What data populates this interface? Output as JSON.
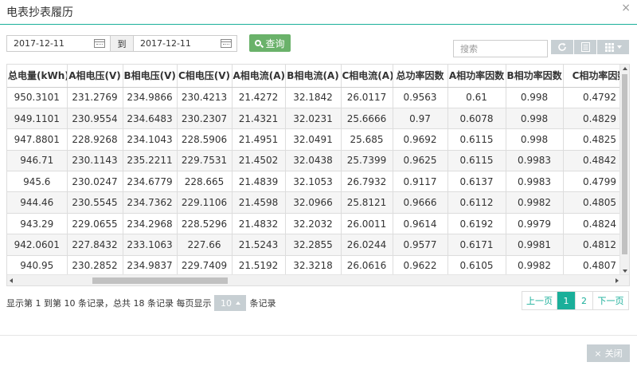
{
  "dialog": {
    "title": "电表抄表履历",
    "close_glyph": "×"
  },
  "filters": {
    "date_from": "2017-12-11",
    "to_label": "到",
    "date_to": "2017-12-11",
    "query_label": "查询"
  },
  "toolbar": {
    "search_placeholder": "搜索",
    "icons": [
      "refresh-icon",
      "list-icon",
      "grid-icon"
    ]
  },
  "table": {
    "columns": [
      "总电量(kWh)",
      "A相电压(V)",
      "B相电压(V)",
      "C相电压(V)",
      "A相电流(A)",
      "B相电流(A)",
      "C相电流(A)",
      "总功率因数",
      "A相功率因数",
      "B相功率因数",
      "C相功率因数"
    ],
    "rows": [
      [
        "950.3101",
        "231.2769",
        "234.9866",
        "230.4213",
        "21.4272",
        "32.1842",
        "26.0117",
        "0.9563",
        "0.61",
        "0.998",
        "0.4792"
      ],
      [
        "949.1101",
        "230.9554",
        "234.6483",
        "230.2307",
        "21.4321",
        "32.0231",
        "25.6666",
        "0.97",
        "0.6078",
        "0.998",
        "0.4829"
      ],
      [
        "947.8801",
        "228.9268",
        "234.1043",
        "228.5906",
        "21.4951",
        "32.0491",
        "25.685",
        "0.9692",
        "0.6115",
        "0.998",
        "0.4825"
      ],
      [
        "946.71",
        "230.1143",
        "235.2211",
        "229.7531",
        "21.4502",
        "32.0438",
        "25.7399",
        "0.9625",
        "0.6115",
        "0.9983",
        "0.4842"
      ],
      [
        "945.6",
        "230.0247",
        "234.6779",
        "228.665",
        "21.4839",
        "32.1053",
        "26.7932",
        "0.9117",
        "0.6137",
        "0.9983",
        "0.4799"
      ],
      [
        "944.46",
        "230.5545",
        "234.7362",
        "229.1106",
        "21.4598",
        "32.0966",
        "25.8121",
        "0.9666",
        "0.6112",
        "0.9982",
        "0.4805"
      ],
      [
        "943.29",
        "229.0655",
        "234.2968",
        "228.5296",
        "21.4832",
        "32.2032",
        "26.0011",
        "0.9614",
        "0.6192",
        "0.9979",
        "0.4824"
      ],
      [
        "942.0601",
        "227.8432",
        "233.1063",
        "227.66",
        "21.5243",
        "32.2855",
        "26.0244",
        "0.9577",
        "0.6171",
        "0.9981",
        "0.4812"
      ],
      [
        "940.95",
        "230.2852",
        "234.9837",
        "229.7409",
        "21.5192",
        "32.3218",
        "26.0616",
        "0.9622",
        "0.6105",
        "0.9982",
        "0.4807"
      ]
    ]
  },
  "pagination": {
    "info_prefix": "显示第 1 到第 10 条记录，总共 18 条记录 每页显示",
    "page_size": "10",
    "info_suffix": "条记录",
    "prev_label": "上一页",
    "pages": [
      "1",
      "2"
    ],
    "active_page": "1",
    "next_label": "下一页"
  },
  "footer": {
    "close_label": "关闭"
  },
  "colors": {
    "accent": "#1aaf9a",
    "query_button": "#6ab26a",
    "gray_button": "#c7cfd3"
  }
}
